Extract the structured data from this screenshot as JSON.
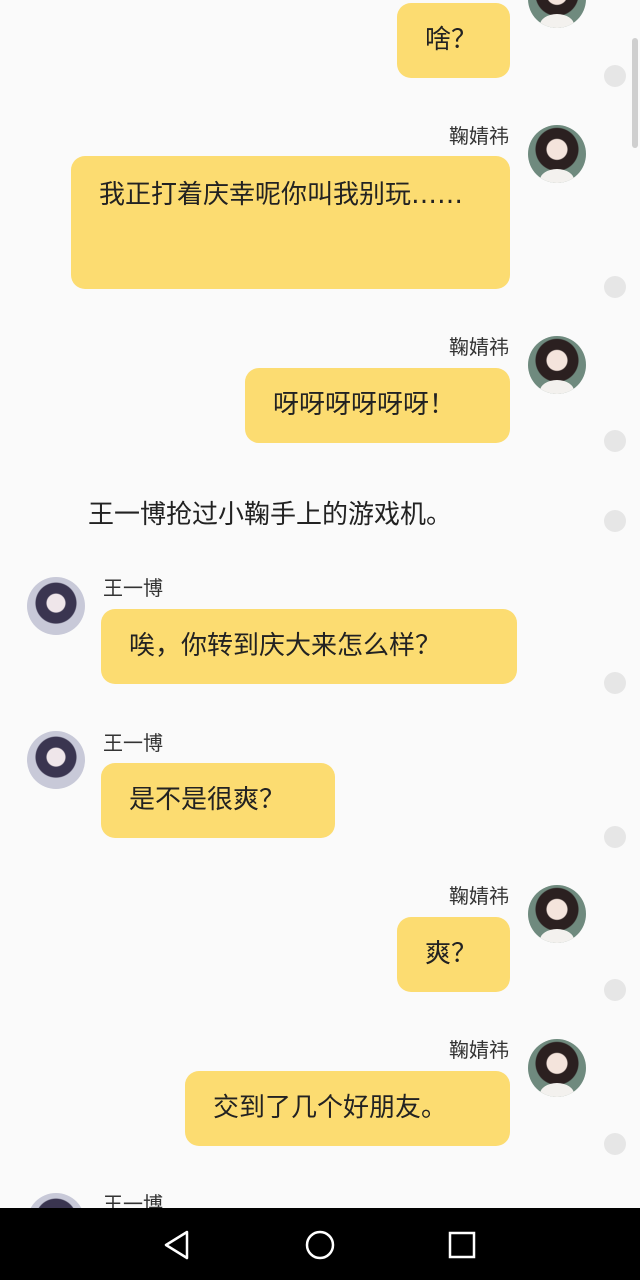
{
  "messages": [
    {
      "speaker": "",
      "text": "啥？"
    },
    {
      "speaker": "鞠婧祎",
      "text": "我正打着庆幸呢你叫我别玩……"
    },
    {
      "speaker": "鞠婧祎",
      "text": "呀呀呀呀呀呀！"
    },
    {
      "narration": "王一博抢过小鞠手上的游戏机。"
    },
    {
      "speaker": "王一博",
      "text": "唉，你转到庆大来怎么样？"
    },
    {
      "speaker": "王一博",
      "text": "是不是很爽？"
    },
    {
      "speaker": "鞠婧祎",
      "text": "爽？"
    },
    {
      "speaker": "鞠婧祎",
      "text": "交到了几个好朋友。"
    },
    {
      "speaker": "王一博",
      "text": ""
    }
  ],
  "nav": {
    "back_icon": "back-triangle-icon",
    "home_icon": "home-circle-icon",
    "recents_icon": "recents-square-icon"
  },
  "colors": {
    "bubble": "#fcdc71",
    "background": "#fafafa",
    "navbar": "#000000"
  }
}
